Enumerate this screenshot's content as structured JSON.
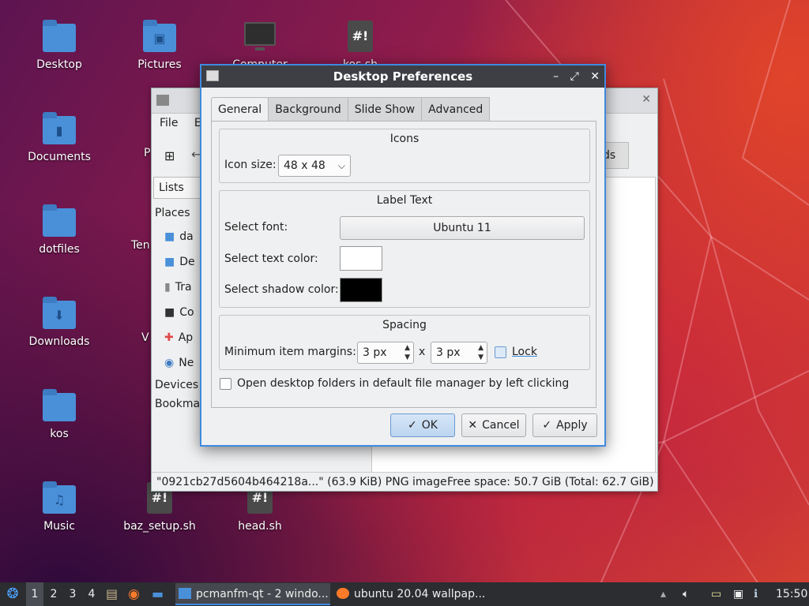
{
  "desktop": {
    "icons": [
      {
        "label": "Desktop",
        "type": "folder"
      },
      {
        "label": "Pictures",
        "type": "folder",
        "symbol": "image-icon"
      },
      {
        "label": "Computer",
        "type": "monitor"
      },
      {
        "label": "kos.sh",
        "type": "script"
      },
      {
        "label": "Documents",
        "type": "folder"
      },
      {
        "label": "dotfiles",
        "type": "folder"
      },
      {
        "label": "Downloads",
        "type": "folder",
        "symbol": "download-icon"
      },
      {
        "label": "kos",
        "type": "folder"
      },
      {
        "label": "Music",
        "type": "folder",
        "symbol": "music-icon"
      },
      {
        "label": "baz_setup.sh",
        "type": "script"
      },
      {
        "label": "head.sh",
        "type": "script"
      }
    ],
    "script_glyph": "#!",
    "partial_labels": {
      "p": "P",
      "ten": "Ten",
      "v": "V"
    }
  },
  "file_manager": {
    "menu": [
      "File",
      "E"
    ],
    "side_label_lists": "Lists",
    "places_heading": "Places",
    "places_items": [
      "da",
      "De",
      "Tra",
      "Co",
      "Ap",
      "Ne"
    ],
    "devices_heading": "Devices",
    "bookmarks_heading": "Bookma",
    "partial_button": "ds",
    "status_file": "\"0921cb27d5604b464218a...\" (63.9 KiB) PNG image",
    "status_free": "Free space: 50.7 GiB (Total: 62.7 GiB)"
  },
  "dialog": {
    "title": "Desktop Preferences",
    "controls": {
      "minimize": "–",
      "maximize": "⤢",
      "close": "✕"
    },
    "tabs": [
      "General",
      "Background",
      "Slide Show",
      "Advanced"
    ],
    "active_tab": "General",
    "icons_group": {
      "title": "Icons",
      "icon_size_label": "Icon size:",
      "icon_size_value": "48 x 48"
    },
    "label_group": {
      "title": "Label Text",
      "font_label": "Select font:",
      "font_value": "Ubuntu 11",
      "text_color_label": "Select text color:",
      "text_color": "#ffffff",
      "shadow_color_label": "Select shadow color:",
      "shadow_color": "#000000"
    },
    "spacing_group": {
      "title": "Spacing",
      "margins_label": "Minimum item margins:",
      "margin_x": "3 px",
      "separator": "x",
      "margin_y": "3 px",
      "lock_label": "Lock"
    },
    "open_folders_label": "Open desktop folders in default file manager by left clicking",
    "buttons": {
      "ok": "OK",
      "cancel": "Cancel",
      "apply": "Apply"
    }
  },
  "taskbar": {
    "workspaces": [
      "1",
      "2",
      "3",
      "4"
    ],
    "active_workspace": "1",
    "tasks": [
      {
        "label": "pcmanfm-qt - 2 windo...",
        "active": true
      },
      {
        "label": "ubuntu 20.04 wallpap...",
        "active": false
      }
    ],
    "clock": "15:50"
  },
  "colors": {
    "accent": "#3f8ae0",
    "folder": "#4a90d9",
    "titlebar": "#3d3f45",
    "taskbar": "#2b2d31"
  }
}
